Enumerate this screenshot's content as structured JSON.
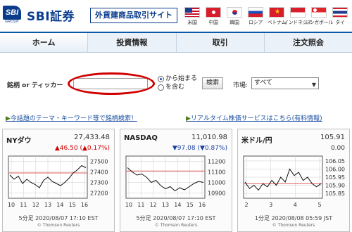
{
  "header": {
    "logo_text": "SBI",
    "logo_sub": "GROUP",
    "brand": "SBI証券",
    "brand_sub": "外貨建商品取引サイト",
    "flags": [
      {
        "label": "米国",
        "icon": "us-flag-icon"
      },
      {
        "label": "中国",
        "icon": "hk-flag-icon"
      },
      {
        "label": "韓国",
        "icon": "kr-flag-icon"
      },
      {
        "label": "ロシア",
        "icon": "ru-flag-icon"
      },
      {
        "label": "ベトナム",
        "icon": "vn-flag-icon"
      },
      {
        "label": "インドネシア",
        "icon": "id-flag-icon"
      },
      {
        "label": "シンガポール",
        "icon": "sg-flag-icon"
      },
      {
        "label": "タイ",
        "icon": "th-flag-icon"
      }
    ]
  },
  "nav": {
    "items": [
      {
        "label": "ホーム",
        "active": true
      },
      {
        "label": "投資情報",
        "active": false
      },
      {
        "label": "取引",
        "active": false
      },
      {
        "label": "注文照会",
        "active": false
      }
    ]
  },
  "search": {
    "label": "銘柄 or ティッカー",
    "input_value": "",
    "radio_starts": "から始まる",
    "radio_contains": "を含む",
    "button": "検索",
    "market_label": "市場:",
    "market_value": "すべて"
  },
  "links": {
    "left": "今話題のテーマ・キーワード等で銘柄検索！",
    "right": "リアルタイム株価サービスはこちら(有料情報)"
  },
  "charts": [
    {
      "name": "NYダウ",
      "price": "27,433.48",
      "change": "▲46.50",
      "change_pct": "(▲0.17%)",
      "direction": "up",
      "footer": "5分足 2020/08/07 17:10 EST",
      "source": "© Thomson Reuters"
    },
    {
      "name": "NASDAQ",
      "price": "11,010.98",
      "change": "▼97.08",
      "change_pct": "(▼0.87%)",
      "direction": "down",
      "footer": "5分足 2020/08/07 17:10 EST",
      "source": "© Thomson Reuters"
    },
    {
      "name": "米ドル/円",
      "price": "105.91",
      "change": "0.00",
      "change_pct": "",
      "direction": "flat",
      "footer": "1分足 2020/08/08 05:59 JST",
      "source": "© Thomson Reuters"
    }
  ],
  "chart_data": [
    {
      "type": "line",
      "title": "NYダウ",
      "x": [
        "10",
        "11",
        "12",
        "13",
        "14",
        "15",
        "16"
      ],
      "ylim": [
        27150,
        27550
      ],
      "yticks": [
        27200,
        27300,
        27400,
        27500
      ],
      "ref_line": 27390,
      "values": [
        27370,
        27330,
        27360,
        27290,
        27330,
        27300,
        27280,
        27250,
        27320,
        27350,
        27310,
        27290,
        27270,
        27300,
        27340,
        27390,
        27420,
        27460,
        27440
      ]
    },
    {
      "type": "line",
      "title": "NASDAQ",
      "x": [
        "10",
        "11",
        "12",
        "13",
        "14",
        "15",
        "16"
      ],
      "ylim": [
        10850,
        11250
      ],
      "yticks": [
        10900,
        11000,
        11100,
        11200
      ],
      "ref_line": 11108,
      "values": [
        11140,
        11100,
        11070,
        11080,
        11050,
        11000,
        11020,
        10970,
        10940,
        10960,
        10920,
        10950,
        10930,
        10960,
        10990,
        11010,
        11000
      ]
    },
    {
      "type": "line",
      "title": "米ドル/円",
      "x": [
        "2",
        "3",
        "4",
        "5"
      ],
      "ylim": [
        105.82,
        106.08
      ],
      "yticks": [
        105.85,
        105.9,
        105.95,
        106.0,
        106.05
      ],
      "ref_line": 105.91,
      "values": [
        105.92,
        105.88,
        105.9,
        105.87,
        105.91,
        105.89,
        105.93,
        105.9,
        105.95,
        105.92,
        106.0,
        105.96,
        105.98,
        105.93,
        105.95,
        105.91,
        105.89,
        105.91
      ]
    }
  ]
}
